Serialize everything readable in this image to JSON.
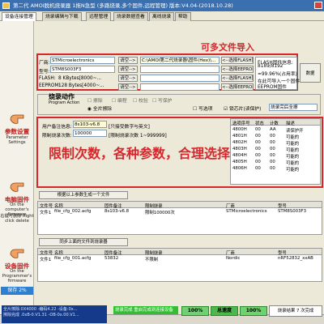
{
  "title": "第二代 AMOI脱机烧录器 1拖N急型 (多路烧录,多个固件,远程管理) 版本:V4.04-(2018.10.28)",
  "tabs": [
    "设备连接管理",
    "烧录编辑与下载",
    "远程管理",
    "烧录数据查看",
    "离线烧录",
    "帮助"
  ],
  "sidebar": {
    "params_label": "参数设置",
    "params_sub": "Parameter Settings",
    "pc_fw_label": "电脑固件",
    "pc_fw_sub": "On the computer's firmware",
    "pc_fw_hint": "右键可删除 Right click delete",
    "dev_fw_label": "设备固件",
    "dev_fw_sub": "On the Programmer's firmware",
    "save_label": "保存 2%"
  },
  "annotations": {
    "multi_file": "可多文件导入",
    "limits": "限制次数，各种参数，合理选择"
  },
  "config": {
    "maker_label": "厂商:",
    "maker_value": "STMicroelectronics",
    "model_label": "型号:",
    "model_value": "STM8S003F3",
    "select_btn": "请空-->",
    "select_btn2": "请空-->",
    "flash_label": "FLASH:",
    "flash_value": "8 KBytes[8000~...",
    "eeprom_label": "EEPROM:",
    "eeprom_value": "128 Bytes[4000~...",
    "file1": "C:\\AMOI第二代烧录器\\固件(Hex)\\...",
    "file2": "",
    "pick_flash": "<--选择FLASH固件",
    "pick_flash2": "<--选择FLASH固件",
    "pick_eeprom": "<--选择EEPROM固件",
    "pick_eeprom2": "<--选择EEPROM固件",
    "fw_info_1": "FLASH固件信息:",
    "fw_info_2": "8189/8192",
    "fw_info_3": "=99.96%(占用率)",
    "fw_info_4": "在此可导入一个固件",
    "fw_info_5": "EEPROM固件",
    "data_btn": "数据"
  },
  "actions": {
    "heading": "烧录动作",
    "heading_en": "Program Action",
    "opt_erase": "擦除",
    "opt_program": "编程",
    "opt_verify": "校验",
    "opt_protect": "写保护",
    "full_erase": "全片擦除",
    "write_option": "写选项",
    "lock_chip": "锁芯片(读保护)",
    "mode_select": "烧录完后全擦"
  },
  "fields": {
    "remark_label": "用户备注信息:",
    "remark_value": "8s103-v6.8",
    "remark_hint": "[只接受数字与英文]",
    "limit_label": "限制烧录次数:",
    "limit_value": "100000",
    "limit_hint": "[限制烧录次数 1~999999]"
  },
  "device_table": {
    "headers": [
      "选项序号",
      "状态",
      "计数",
      "描述"
    ],
    "rows": [
      [
        "4800H",
        "00",
        "AA",
        "读保护开"
      ],
      [
        "4801H",
        "00",
        "00",
        "可能的"
      ],
      [
        "4802H",
        "00",
        "00",
        "可能的"
      ],
      [
        "4803H",
        "00",
        "00",
        "可能的"
      ],
      [
        "4804H",
        "00",
        "00",
        "可能的"
      ],
      [
        "4805H",
        "00",
        "00",
        "可能的"
      ],
      [
        "4806H",
        "00",
        "00",
        "可能的"
      ]
    ]
  },
  "gen_button": "根据以上参数生成一个文件",
  "pc_list": {
    "headers": [
      "文件号",
      "名称",
      "固件备注",
      "限制烧录",
      "厂商",
      "型号"
    ],
    "rows": [
      [
        "文件1",
        "file_cfg_002.acfg",
        "8s103-v6.8",
        "限制100000次",
        "STMicroelectronics",
        "STM8S003F3"
      ]
    ]
  },
  "sync_button": "同步上面的文件到烧录器",
  "dev_list": {
    "headers": [
      "文件号",
      "名称",
      "固件备注",
      "限制烧录",
      "厂商",
      "型号"
    ],
    "rows": [
      [
        "文件1",
        "file_cfg_001.acfg",
        "53832",
        "不限制",
        "Nordic",
        "nRF52832_xxAB"
      ]
    ]
  },
  "status": {
    "left": "全片擦除:0X4000 -编码4.22 -设备:0x...",
    "left2": "擦除完成 .0xB-0.V1.31 -OB-0x.00.V1...",
    "mid": "烧录完成  重启完成到连接设备",
    "pct1": "100%",
    "ok": "总速度",
    "pct2": "100%",
    "right": "烧录结果 7 次完成"
  }
}
